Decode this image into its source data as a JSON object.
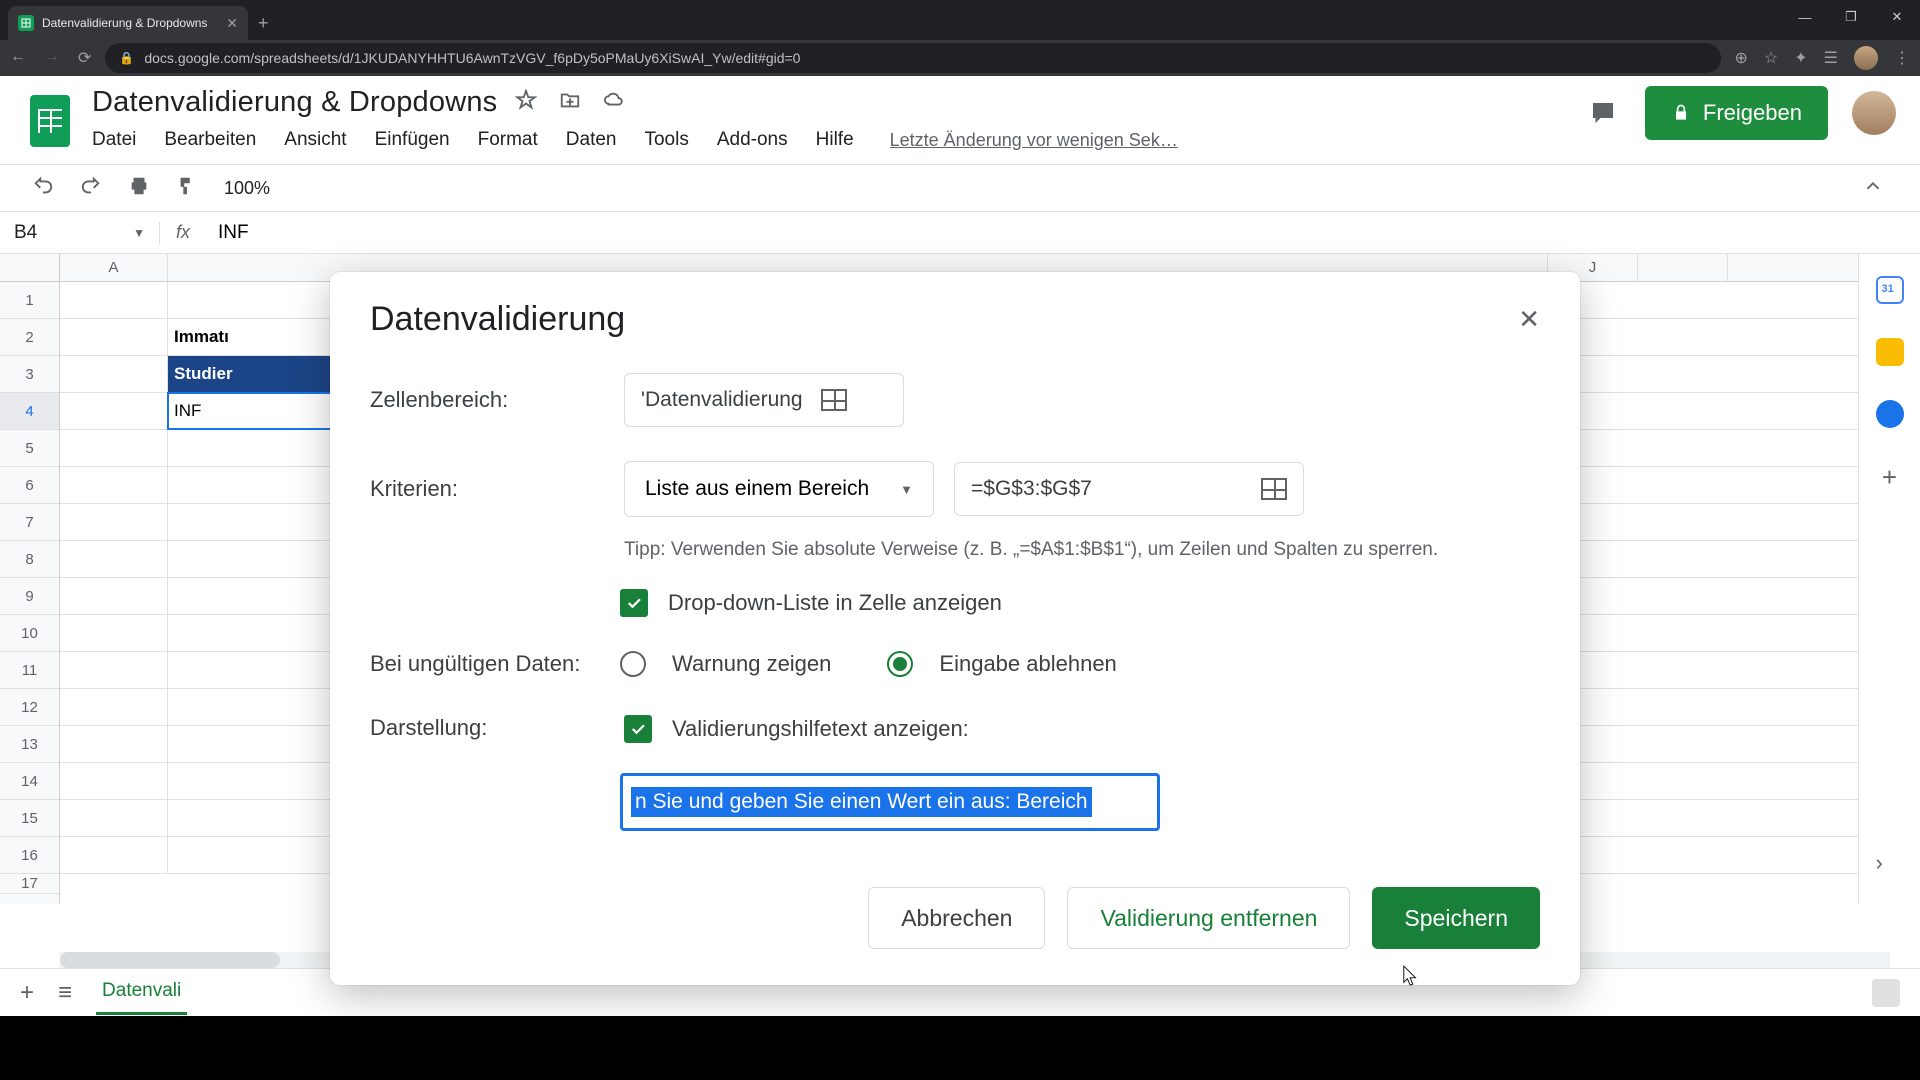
{
  "browser": {
    "tab_title": "Datenvalidierung & Dropdowns",
    "url": "docs.google.com/spreadsheets/d/1JKUDANYHHTU6AwnTzVGV_f6pDy5oPMaUy6XiSwAI_Yw/edit#gid=0"
  },
  "doc": {
    "title": "Datenvalidierung & Dropdowns",
    "share_button": "Freigeben",
    "last_edit": "Letzte Änderung vor wenigen Sek…"
  },
  "menu": {
    "file": "Datei",
    "edit": "Bearbeiten",
    "view": "Ansicht",
    "insert": "Einfügen",
    "format": "Format",
    "data": "Daten",
    "tools": "Tools",
    "addons": "Add-ons",
    "help": "Hilfe"
  },
  "toolbar": {
    "zoom": "100%"
  },
  "namebox": {
    "cell": "B4",
    "formula": "INF"
  },
  "columns": {
    "A": "A",
    "J": "J"
  },
  "cells": {
    "b2": "Immatı",
    "b3": "Studier",
    "b4": "INF"
  },
  "sheet_tab": "Datenvali",
  "modal": {
    "title": "Datenvalidierung",
    "cell_range_label": "Zellenbereich:",
    "cell_range_value": "'Datenvalidierung",
    "criteria_label": "Kriterien:",
    "criteria_type": "Liste aus einem Bereich",
    "criteria_range": "=$G$3:$G$7",
    "tip_text": "Tipp: Verwenden Sie absolute Verweise (z. B. „=$A$1:$B$1“), um Zeilen und Spalten zu sperren.",
    "show_dropdown_label": "Drop-down-Liste in Zelle anzeigen",
    "invalid_label": "Bei ungültigen Daten:",
    "invalid_warn": "Warnung zeigen",
    "invalid_reject": "Eingabe ablehnen",
    "appearance_label": "Darstellung:",
    "show_help_label": "Validierungshilfetext anzeigen:",
    "help_text_value": "n Sie und geben Sie einen Wert ein aus: Bereich",
    "cancel": "Abbrechen",
    "remove": "Validierung entfernen",
    "save": "Speichern"
  }
}
